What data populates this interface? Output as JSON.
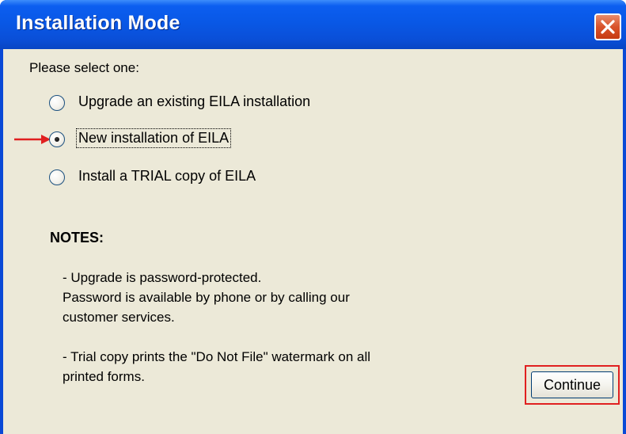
{
  "window": {
    "title": "Installation Mode"
  },
  "dialog": {
    "prompt": "Please select one:",
    "options": [
      {
        "label": "Upgrade an existing EILA installation",
        "selected": false
      },
      {
        "label": "New installation of EILA",
        "selected": true
      },
      {
        "label": "Install a TRIAL copy of EILA",
        "selected": false
      }
    ],
    "notes": {
      "title": "NOTES:",
      "lines": [
        "- Upgrade is password-protected.",
        "Password is available by phone or by calling our",
        "customer services.",
        "",
        "- Trial copy prints the \"Do Not File\" watermark on all",
        "printed forms."
      ]
    },
    "continue_label": "Continue"
  },
  "colors": {
    "titlebar": "#0958e6",
    "client_background": "#ece9d8",
    "close_button": "#d9532b",
    "annotation": "#e02020"
  },
  "icons": {
    "close": "close-icon",
    "annotation_arrow": "arrow-right-icon"
  }
}
